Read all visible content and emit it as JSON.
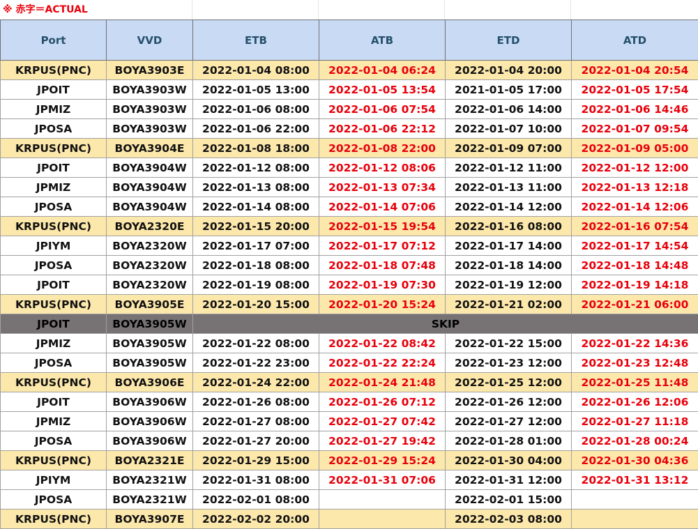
{
  "note": "※ 赤字＝ACTUAL",
  "headers": {
    "port": "Port",
    "vvd": "VVD",
    "etb": "ETB",
    "atb": "ATB",
    "etd": "ETD",
    "atd": "ATD"
  },
  "skip_label": "SKIP",
  "colors": {
    "header_bg": "#c9daf5",
    "header_text": "#24506a",
    "actual_text": "#e8000b",
    "korea_row_bg": "#fde8ac",
    "skip_row_bg": "#777273"
  },
  "rows": [
    {
      "port": "KRPUS(PNC)",
      "vvd": "BOYA3903E",
      "etb": "2022-01-04 08:00",
      "atb": "2022-01-04 06:24",
      "etd": "2022-01-04 20:00",
      "atd": "2022-01-04 20:54"
    },
    {
      "port": "JPOIT",
      "vvd": "BOYA3903W",
      "etb": "2022-01-05 13:00",
      "atb": "2022-01-05 13:54",
      "etd": "2021-01-05 17:00",
      "atd": "2022-01-05 17:54"
    },
    {
      "port": "JPMIZ",
      "vvd": "BOYA3903W",
      "etb": "2022-01-06 08:00",
      "atb": "2022-01-06 07:54",
      "etd": "2022-01-06 14:00",
      "atd": "2022-01-06 14:46"
    },
    {
      "port": "JPOSA",
      "vvd": "BOYA3903W",
      "etb": "2022-01-06 22:00",
      "atb": "2022-01-06 22:12",
      "etd": "2022-01-07 10:00",
      "atd": "2022-01-07 09:54"
    },
    {
      "port": "KRPUS(PNC)",
      "vvd": "BOYA3904E",
      "etb": "2022-01-08 18:00",
      "atb": "2022-01-08 22:00",
      "etd": "2022-01-09 07:00",
      "atd": "2022-01-09 05:00"
    },
    {
      "port": "JPOIT",
      "vvd": "BOYA3904W",
      "etb": "2022-01-12 08:00",
      "atb": "2022-01-12 08:06",
      "etd": "2022-01-12 11:00",
      "atd": "2022-01-12 12:00"
    },
    {
      "port": "JPMIZ",
      "vvd": "BOYA3904W",
      "etb": "2022-01-13 08:00",
      "atb": "2022-01-13 07:34",
      "etd": "2022-01-13 11:00",
      "atd": "2022-01-13 12:18"
    },
    {
      "port": "JPOSA",
      "vvd": "BOYA3904W",
      "etb": "2022-01-14 08:00",
      "atb": "2022-01-14 07:06",
      "etd": "2022-01-14 12:00",
      "atd": "2022-01-14 12:06"
    },
    {
      "port": "KRPUS(PNC)",
      "vvd": "BOYA2320E",
      "etb": "2022-01-15 20:00",
      "atb": "2022-01-15 19:54",
      "etd": "2022-01-16 08:00",
      "atd": "2022-01-16 07:54"
    },
    {
      "port": "JPIYM",
      "vvd": "BOYA2320W",
      "etb": "2022-01-17 07:00",
      "atb": "2022-01-17 07:12",
      "etd": "2022-01-17 14:00",
      "atd": "2022-01-17 14:54"
    },
    {
      "port": "JPOSA",
      "vvd": "BOYA2320W",
      "etb": "2022-01-18 08:00",
      "atb": "2022-01-18 07:48",
      "etd": "2022-01-18 14:00",
      "atd": "2022-01-18 14:48"
    },
    {
      "port": "JPOIT",
      "vvd": "BOYA2320W",
      "etb": "2022-01-19 08:00",
      "atb": "2022-01-19 07:30",
      "etd": "2022-01-19 12:00",
      "atd": "2022-01-19 14:18"
    },
    {
      "port": "KRPUS(PNC)",
      "vvd": "BOYA3905E",
      "etb": "2022-01-20 15:00",
      "atb": "2022-01-20 15:24",
      "etd": "2022-01-21 02:00",
      "atd": "2022-01-21 06:00"
    },
    {
      "port": "JPOIT",
      "vvd": "BOYA3905W",
      "skip": true
    },
    {
      "port": "JPMIZ",
      "vvd": "BOYA3905W",
      "etb": "2022-01-22 08:00",
      "atb": "2022-01-22 08:42",
      "etd": "2022-01-22 15:00",
      "atd": "2022-01-22 14:36"
    },
    {
      "port": "JPOSA",
      "vvd": "BOYA3905W",
      "etb": "2022-01-22 23:00",
      "atb": "2022-01-22 22:24",
      "etd": "2022-01-23 12:00",
      "atd": "2022-01-23 12:48"
    },
    {
      "port": "KRPUS(PNC)",
      "vvd": "BOYA3906E",
      "etb": "2022-01-24 22:00",
      "atb": "2022-01-24 21:48",
      "etd": "2022-01-25 12:00",
      "atd": "2022-01-25 11:48"
    },
    {
      "port": "JPOIT",
      "vvd": "BOYA3906W",
      "etb": "2022-01-26 08:00",
      "atb": "2022-01-26 07:12",
      "etd": "2022-01-26 12:00",
      "atd": "2022-01-26 12:06"
    },
    {
      "port": "JPMIZ",
      "vvd": "BOYA3906W",
      "etb": "2022-01-27 08:00",
      "atb": "2022-01-27 07:42",
      "etd": "2022-01-27 12:00",
      "atd": "2022-01-27 11:18"
    },
    {
      "port": "JPOSA",
      "vvd": "BOYA3906W",
      "etb": "2022-01-27 20:00",
      "atb": "2022-01-27 19:42",
      "etd": "2022-01-28 01:00",
      "atd": "2022-01-28 00:24"
    },
    {
      "port": "KRPUS(PNC)",
      "vvd": "BOYA2321E",
      "etb": "2022-01-29 15:00",
      "atb": "2022-01-29 15:24",
      "etd": "2022-01-30 04:00",
      "atd": "2022-01-30 04:36"
    },
    {
      "port": "JPIYM",
      "vvd": "BOYA2321W",
      "etb": "2022-01-31 08:00",
      "atb": "2022-01-31 07:06",
      "etd": "2022-01-31 12:00",
      "atd": "2022-01-31 13:12"
    },
    {
      "port": "JPOSA",
      "vvd": "BOYA2321W",
      "etb": "2022-02-01 08:00",
      "atb": "",
      "etd": "2022-02-01 15:00",
      "atd": ""
    },
    {
      "port": "KRPUS(PNC)",
      "vvd": "BOYA3907E",
      "etb": "2022-02-02 20:00",
      "atb": "",
      "etd": "2022-02-03 08:00",
      "atd": ""
    }
  ]
}
